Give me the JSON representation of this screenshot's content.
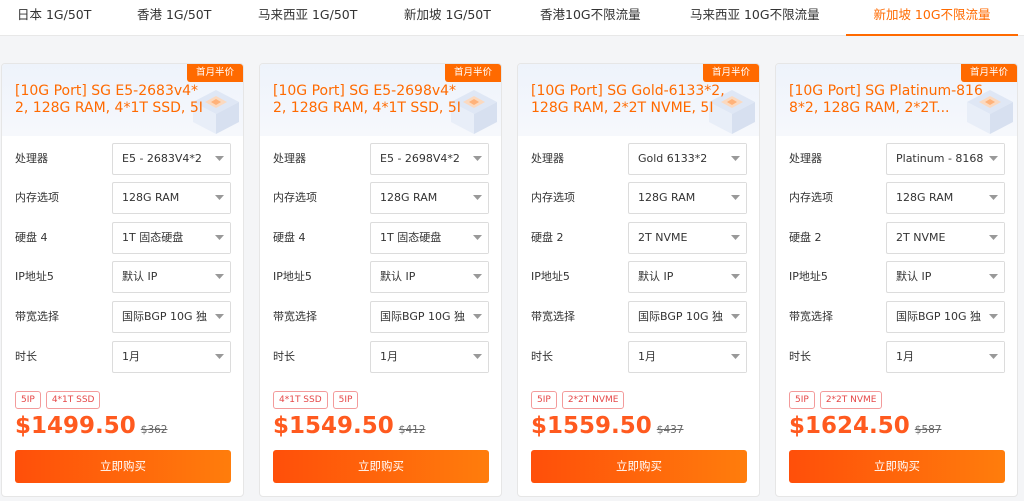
{
  "tabs": [
    {
      "label": "日本 1G/50T"
    },
    {
      "label": "香港 1G/50T"
    },
    {
      "label": "马来西亚 1G/50T"
    },
    {
      "label": "新加坡 1G/50T"
    },
    {
      "label": "香港10G不限流量"
    },
    {
      "label": "马来西亚 10G不限流量"
    },
    {
      "label": "新加坡 10G不限流量"
    }
  ],
  "active_tab": "新加坡 10G不限流量",
  "colors": {
    "accent": "#ff6a00",
    "price": "#ff5a1f",
    "tag": "#e54848"
  },
  "field_labels": [
    "处理器",
    "内存选项",
    "硬盘",
    "IP地址5",
    "带宽选择",
    "时长"
  ],
  "cards": [
    {
      "badge": "首月半价",
      "title": "[10G Port] SG E5-2683v4*2, 128G RAM, 4*1T SSD, 5IP,...",
      "fields": [
        {
          "label": "处理器",
          "value": "E5 - 2683V4*2"
        },
        {
          "label": "内存选项",
          "value": "128G RAM"
        },
        {
          "label": "硬盘 4",
          "value": "1T 固态硬盘"
        },
        {
          "label": "IP地址5",
          "value": "默认 IP"
        },
        {
          "label": "带宽选择",
          "value": "国际BGP 10G 独"
        },
        {
          "label": "时长",
          "value": "1月"
        }
      ],
      "tags": [
        "5IP",
        "4*1T SSD"
      ],
      "price": "$1499.50",
      "old_price": "$362",
      "buy_label": "立即购买"
    },
    {
      "badge": "首月半价",
      "title": "[10G Port] SG E5-2698v4*2, 128G RAM, 4*1T SSD, 5IP,...",
      "fields": [
        {
          "label": "处理器",
          "value": "E5 - 2698V4*2"
        },
        {
          "label": "内存选项",
          "value": "128G RAM"
        },
        {
          "label": "硬盘 4",
          "value": "1T 固态硬盘"
        },
        {
          "label": "IP地址5",
          "value": "默认 IP"
        },
        {
          "label": "带宽选择",
          "value": "国际BGP 10G 独"
        },
        {
          "label": "时长",
          "value": "1月"
        }
      ],
      "tags": [
        "4*1T SSD",
        "5IP"
      ],
      "price": "$1549.50",
      "old_price": "$412",
      "buy_label": "立即购买"
    },
    {
      "badge": "首月半价",
      "title": "[10G Port] SG Gold-6133*2, 128G RAM, 2*2T NVME, 5IP,...",
      "fields": [
        {
          "label": "处理器",
          "value": "Gold 6133*2"
        },
        {
          "label": "内存选项",
          "value": "128G RAM"
        },
        {
          "label": "硬盘 2",
          "value": "2T NVME"
        },
        {
          "label": "IP地址5",
          "value": "默认 IP"
        },
        {
          "label": "带宽选择",
          "value": "国际BGP 10G 独"
        },
        {
          "label": "时长",
          "value": "1月"
        }
      ],
      "tags": [
        "5IP",
        "2*2T NVME"
      ],
      "price": "$1559.50",
      "old_price": "$437",
      "buy_label": "立即购买"
    },
    {
      "badge": "首月半价",
      "title": "[10G Port] SG Platinum-8168*2, 128G RAM, 2*2T...",
      "fields": [
        {
          "label": "处理器",
          "value": "Platinum - 8168"
        },
        {
          "label": "内存选项",
          "value": "128G RAM"
        },
        {
          "label": "硬盘 2",
          "value": "2T NVME"
        },
        {
          "label": "IP地址5",
          "value": "默认 IP"
        },
        {
          "label": "带宽选择",
          "value": "国际BGP 10G 独"
        },
        {
          "label": "时长",
          "value": "1月"
        }
      ],
      "tags": [
        "5IP",
        "2*2T NVME"
      ],
      "price": "$1624.50",
      "old_price": "$587",
      "buy_label": "立即购买"
    }
  ]
}
